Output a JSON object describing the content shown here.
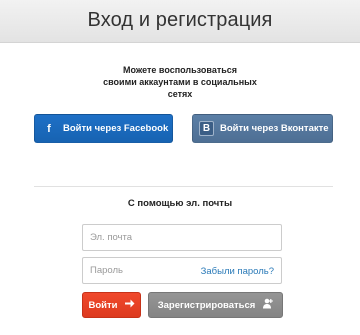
{
  "header": {
    "title": "Вход и регистрация"
  },
  "social": {
    "intro_line1": "Можете воспользоваться",
    "intro_line2": "своими аккаунтами в социальных",
    "intro_line3": "сетях",
    "facebook_label": "Войти через Facebook",
    "facebook_icon": "f",
    "vk_label": "Войти через Вконтакте",
    "vk_icon": "B"
  },
  "email": {
    "title": "С помощью эл. почты",
    "email_placeholder": "Эл. почта",
    "password_placeholder": "Пароль",
    "forgot_link": "Забыли пароль?"
  },
  "actions": {
    "login_label": "Войти",
    "register_label": "Зарегистрироваться"
  },
  "colors": {
    "facebook": "#1a6abc",
    "vk": "#5676a0",
    "login": "#e8421f",
    "register": "#8c8c8c",
    "link": "#2a7ab8"
  }
}
